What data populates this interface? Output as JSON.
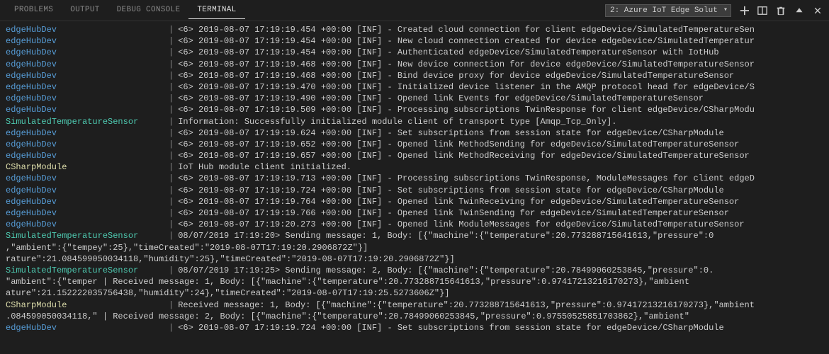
{
  "tabs": {
    "problems": "PROBLEMS",
    "output": "OUTPUT",
    "debug_console": "DEBUG CONSOLE",
    "terminal": "TERMINAL"
  },
  "toolbar": {
    "terminal_selector": "2: Azure IoT Edge Solut",
    "new_terminal_tip": "New Terminal",
    "split_terminal_tip": "Split Terminal",
    "kill_terminal_tip": "Kill Terminal",
    "maximize_tip": "Maximize",
    "close_tip": "Close"
  },
  "sources": {
    "edgehub": "edgeHubDev",
    "sim": "SimulatedTemperatureSensor",
    "csharp": "CSharpModule"
  },
  "logs": [
    {
      "src": "edgehub",
      "msg": "<6> 2019-08-07 17:19:19.454 +00:00 [INF] - Created cloud connection for client edgeDevice/SimulatedTemperatureSen"
    },
    {
      "src": "edgehub",
      "msg": "<6> 2019-08-07 17:19:19.454 +00:00 [INF] - New cloud connection created for device edgeDevice/SimulatedTemperatur"
    },
    {
      "src": "edgehub",
      "msg": "<6> 2019-08-07 17:19:19.454 +00:00 [INF] - Authenticated edgeDevice/SimulatedTemperatureSensor with IotHub"
    },
    {
      "src": "edgehub",
      "msg": "<6> 2019-08-07 17:19:19.468 +00:00 [INF] - New device connection for device edgeDevice/SimulatedTemperatureSensor"
    },
    {
      "src": "edgehub",
      "msg": "<6> 2019-08-07 17:19:19.468 +00:00 [INF] - Bind device proxy for device edgeDevice/SimulatedTemperatureSensor"
    },
    {
      "src": "edgehub",
      "msg": "<6> 2019-08-07 17:19:19.470 +00:00 [INF] - Initialized device listener in the AMQP protocol head for edgeDevice/S"
    },
    {
      "src": "edgehub",
      "msg": "<6> 2019-08-07 17:19:19.490 +00:00 [INF] - Opened link Events for edgeDevice/SimulatedTemperatureSensor"
    },
    {
      "src": "edgehub",
      "msg": "<6> 2019-08-07 17:19:19.509 +00:00 [INF] - Processing subscriptions TwinResponse for client edgeDevice/CSharpModu"
    },
    {
      "src": "sim",
      "msg": "Information: Successfully initialized module client of transport type [Amqp_Tcp_Only]."
    },
    {
      "src": "edgehub",
      "msg": "<6> 2019-08-07 17:19:19.624 +00:00 [INF] - Set subscriptions from session state for edgeDevice/CSharpModule"
    },
    {
      "src": "edgehub",
      "msg": "<6> 2019-08-07 17:19:19.652 +00:00 [INF] - Opened link MethodSending for edgeDevice/SimulatedTemperatureSensor"
    },
    {
      "src": "edgehub",
      "msg": "<6> 2019-08-07 17:19:19.657 +00:00 [INF] - Opened link MethodReceiving for edgeDevice/SimulatedTemperatureSensor"
    },
    {
      "src": "csharp",
      "msg": "IoT Hub module client initialized."
    },
    {
      "src": "edgehub",
      "msg": "<6> 2019-08-07 17:19:19.713 +00:00 [INF] - Processing subscriptions TwinResponse, ModuleMessages for client edgeD"
    },
    {
      "src": "edgehub",
      "msg": "<6> 2019-08-07 17:19:19.724 +00:00 [INF] - Set subscriptions from session state for edgeDevice/CSharpModule"
    },
    {
      "src": "edgehub",
      "msg": "<6> 2019-08-07 17:19:19.764 +00:00 [INF] - Opened link TwinReceiving for edgeDevice/SimulatedTemperatureSensor"
    },
    {
      "src": "edgehub",
      "msg": "<6> 2019-08-07 17:19:19.766 +00:00 [INF] - Opened link TwinSending for edgeDevice/SimulatedTemperatureSensor"
    },
    {
      "src": "edgehub",
      "msg": "<6> 2019-08-07 17:19:20.273 +00:00 [INF] - Opened link ModuleMessages for edgeDevice/SimulatedTemperatureSensor"
    },
    {
      "src": "sim",
      "msg": "        08/07/2019 17:19:20> Sending message: 1, Body: [{\"machine\":{\"temperature\":20.773288715641613,\"pressure\":0"
    },
    {
      "wrap": ",\"ambient\":{\"tempey\":25},\"timeCreated\":\"2019-08-07T17:19:20.2906872Z\"}]"
    },
    {
      "wrap": "rature\":21.084599050034118,\"humidity\":25},\"timeCreated\":\"2019-08-07T17:19:20.2906872Z\"}]"
    },
    {
      "src": "sim",
      "msg": "        08/07/2019 17:19:25> Sending message: 2, Body: [{\"machine\":{\"temperature\":20.78499060253845,\"pressure\":0."
    },
    {
      "wrap": "\"ambient\":{\"temper    | Received message: 1, Body: [{\"machine\":{\"temperature\":20.773288715641613,\"pressure\":0.97417213216170273},\"ambient"
    },
    {
      "wrap": "ature\":21.152222035756438,\"humidity\":24},\"timeCreated\":\"2019-08-07T17:19:25.5273606Z\"}]"
    },
    {
      "src": "csharp",
      "msg": "Received message: 1, Body: [{\"machine\":{\"temperature\":20.773288715641613,\"pressure\":0.97417213216170273},\"ambient"
    },
    {
      "wrap": ".084599050034118,\"    | Received message: 2, Body: [{\"machine\":{\"temperature\":20.78499060253845,\"pressure\":0.97550525851703862},\"ambient\""
    },
    {
      "src": "edgehub",
      "msg": "<6> 2019-08-07 17:19:19.724 +00:00 [INF] - Set subscriptions from session state for edgeDevice/CSharpModule"
    }
  ]
}
